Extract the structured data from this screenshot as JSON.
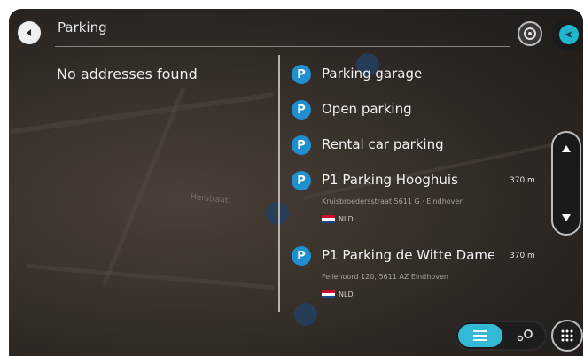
{
  "search": {
    "query": "Parking"
  },
  "left_panel": {
    "message": "No addresses found"
  },
  "map": {
    "street_label": "Herstraat"
  },
  "categories": [
    {
      "label": "Parking garage",
      "icon": "parking-garage-icon"
    },
    {
      "label": "Open parking",
      "icon": "open-parking-icon"
    },
    {
      "label": "Rental car parking",
      "icon": "rental-car-parking-icon"
    }
  ],
  "pois": [
    {
      "title": "P1 Parking Hooghuis",
      "distance": "370 m",
      "address": "Kruisbroedersstraat 5611 G · Eindhoven",
      "country": "NLD"
    },
    {
      "title": "P1 Parking de Witte Dame",
      "distance": "370 m",
      "address": "Fellenoord 120, 5611 AZ Eindhoven",
      "country": "NLD"
    }
  ],
  "colors": {
    "accent": "#33b8d6",
    "parking_icon": "#1f8fd0",
    "background": "#2a2521"
  }
}
